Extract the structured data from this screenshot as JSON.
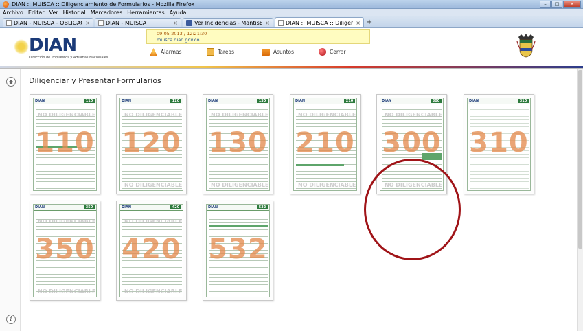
{
  "window": {
    "title": "DIAN :: MUISCA :: Diligenciamiento de Formularios - Mozilla Firefox",
    "controls": [
      "–",
      "□",
      "✕"
    ]
  },
  "menu": [
    "Archivo",
    "Editar",
    "Ver",
    "Historial",
    "Marcadores",
    "Herramientas",
    "Ayuda"
  ],
  "tabs": [
    {
      "label": "DIAN - MUISCA - OBLIGACION FINA...",
      "active": false
    },
    {
      "label": "DIAN - MUISCA",
      "active": false
    },
    {
      "label": "Ver Incidencias - MantisBT",
      "active": false
    },
    {
      "label": "DIAN :: MUISCA :: Diligenciamiento d...",
      "active": true
    }
  ],
  "header": {
    "logo_text": "DIAN",
    "logo_subtitle": "Dirección de Impuestos y Aduanas Nacionales",
    "user_line1": "09-05-2013 / 12:21:30",
    "user_line2": "muisca.dian.gov.co",
    "links": [
      {
        "label": "Alarmas",
        "icon": "alarm-icon"
      },
      {
        "label": "Tareas",
        "icon": "task-icon"
      },
      {
        "label": "Asuntos",
        "icon": "folder-icon"
      },
      {
        "label": "Cerrar",
        "icon": "close-session-icon"
      }
    ]
  },
  "page_title": "Diligenciar y Presentar Formularios",
  "watermark": "NO DILIGENCIABLE",
  "forms": [
    {
      "number": "110"
    },
    {
      "number": "120"
    },
    {
      "number": "130"
    },
    {
      "number": "210"
    },
    {
      "number": "300"
    },
    {
      "number": "310"
    },
    {
      "number": "350"
    },
    {
      "number": "420"
    },
    {
      "number": "532"
    }
  ],
  "colors": {
    "accent_blue": "#1b3a78",
    "form_green": "#2d7a3d",
    "number_orange": "#e48c50",
    "highlight_circle": "#a01418"
  }
}
